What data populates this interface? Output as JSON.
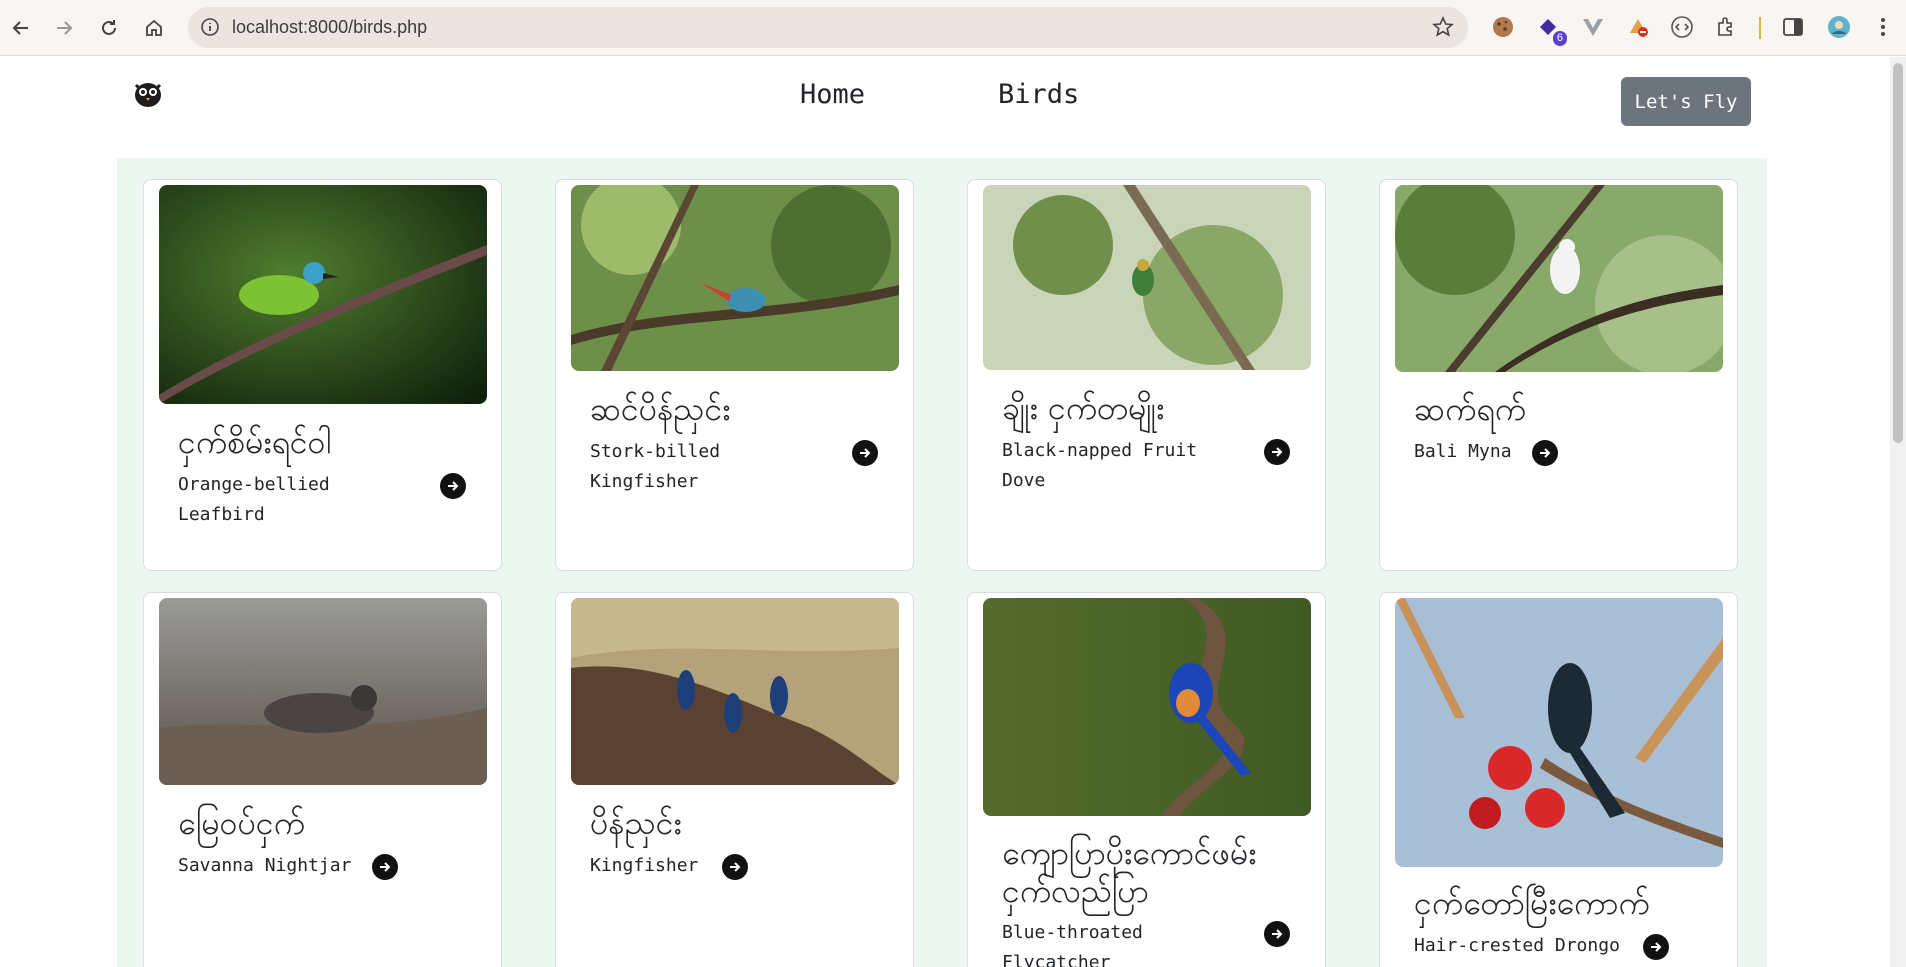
{
  "browser": {
    "url": "localhost:8000/birds.php",
    "extension_badge": "6"
  },
  "header": {
    "nav": [
      {
        "label": "Home"
      },
      {
        "label": "Birds"
      }
    ],
    "cta_label": "Let's Fly"
  },
  "birds": [
    {
      "name_mm": "ငှက်စိမ်းရင်ဝါ",
      "name_en": "Orange-bellied Leafbird",
      "photo": "green leafbird perched on a branch"
    },
    {
      "name_mm": "ဆင်ပိန်ညှင်း",
      "name_en": "Stork-billed Kingfisher",
      "photo": "kingfisher among tree branches"
    },
    {
      "name_mm": "ချိုး ငှက်တမျိုး",
      "name_en": "Black-napped Fruit Dove",
      "photo": "fruit dove in leafy tree"
    },
    {
      "name_mm": "ဆက်ရက်",
      "name_en": "Bali Myna",
      "photo": "white myna on a branch"
    },
    {
      "name_mm": "မြေဝပ်ငှက်",
      "name_en": "Savanna Nightjar",
      "photo": "nightjar camouflaged on the ground"
    },
    {
      "name_mm": "ပိန်ညှင်း",
      "name_en": "Kingfisher",
      "photo": "three kingfishers on a dirt mound"
    },
    {
      "name_mm": "ကျောပြာပိုးကောင်ဖမ်းငှက်လည်ပြာ",
      "name_en": "Blue-throated Flycatcher",
      "photo": "blue flycatcher on a twisted branch"
    },
    {
      "name_mm": "ငှက်တော်မြီးကောက်",
      "name_en": "Hair-crested Drongo",
      "photo": "drongo among red flowers"
    }
  ],
  "colors": {
    "content_bg": "#edf7f2",
    "cta_bg": "#6c757d",
    "go_icon": "#111111"
  }
}
